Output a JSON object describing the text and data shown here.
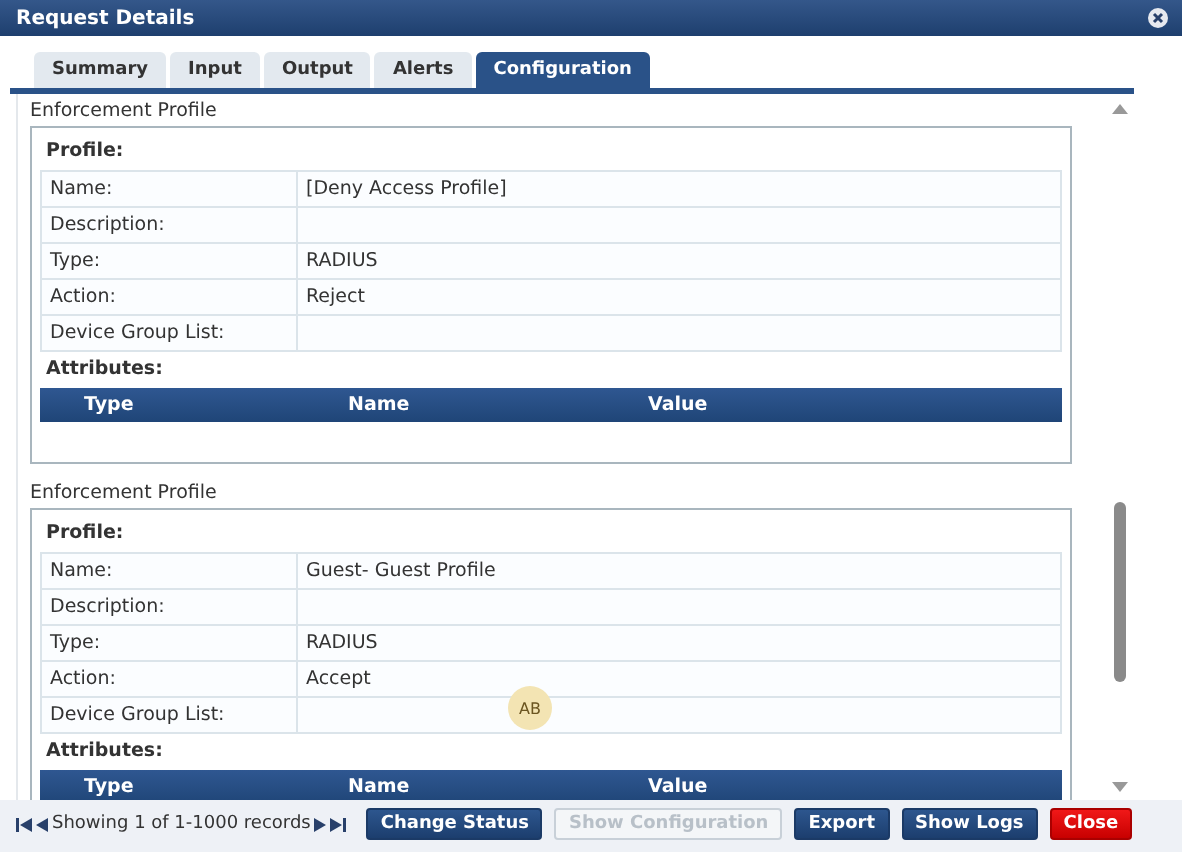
{
  "window": {
    "title": "Request Details"
  },
  "tabs": [
    {
      "label": "Summary",
      "selected": false
    },
    {
      "label": "Input",
      "selected": false
    },
    {
      "label": "Output",
      "selected": false
    },
    {
      "label": "Alerts",
      "selected": false
    },
    {
      "label": "Configuration",
      "selected": true
    }
  ],
  "profiles": [
    {
      "heading": "Enforcement Profile",
      "section_title": "Profile:",
      "fields": [
        {
          "label": "Name:",
          "value": "[Deny Access Profile]"
        },
        {
          "label": "Description:"
        },
        {
          "label": "Type:",
          "value": "RADIUS"
        },
        {
          "label": "Action:",
          "value": "Reject"
        },
        {
          "label": "Device Group List:"
        }
      ],
      "attributes_title": "Attributes:",
      "attribute_columns": [
        "Type",
        "Name",
        "Value"
      ]
    },
    {
      "heading": "Enforcement Profile",
      "section_title": "Profile:",
      "fields": [
        {
          "label": "Name:",
          "value": "Guest- Guest Profile"
        },
        {
          "label": "Description:"
        },
        {
          "label": "Type:",
          "value": "RADIUS"
        },
        {
          "label": "Action:",
          "value": "Accept"
        },
        {
          "label": "Device Group List:"
        }
      ],
      "attributes_title": "Attributes:",
      "attribute_columns": [
        "Type",
        "Name",
        "Value"
      ]
    }
  ],
  "badge": "AB",
  "footer": {
    "pager": "Showing 1 of 1-1000 records",
    "buttons": [
      {
        "label": "Change Status",
        "kind": "primary"
      },
      {
        "label": "Show Configuration",
        "kind": "disabled"
      },
      {
        "label": "Export",
        "kind": "primary"
      },
      {
        "label": "Show Logs",
        "kind": "primary"
      },
      {
        "label": "Close",
        "kind": "danger"
      }
    ]
  }
}
